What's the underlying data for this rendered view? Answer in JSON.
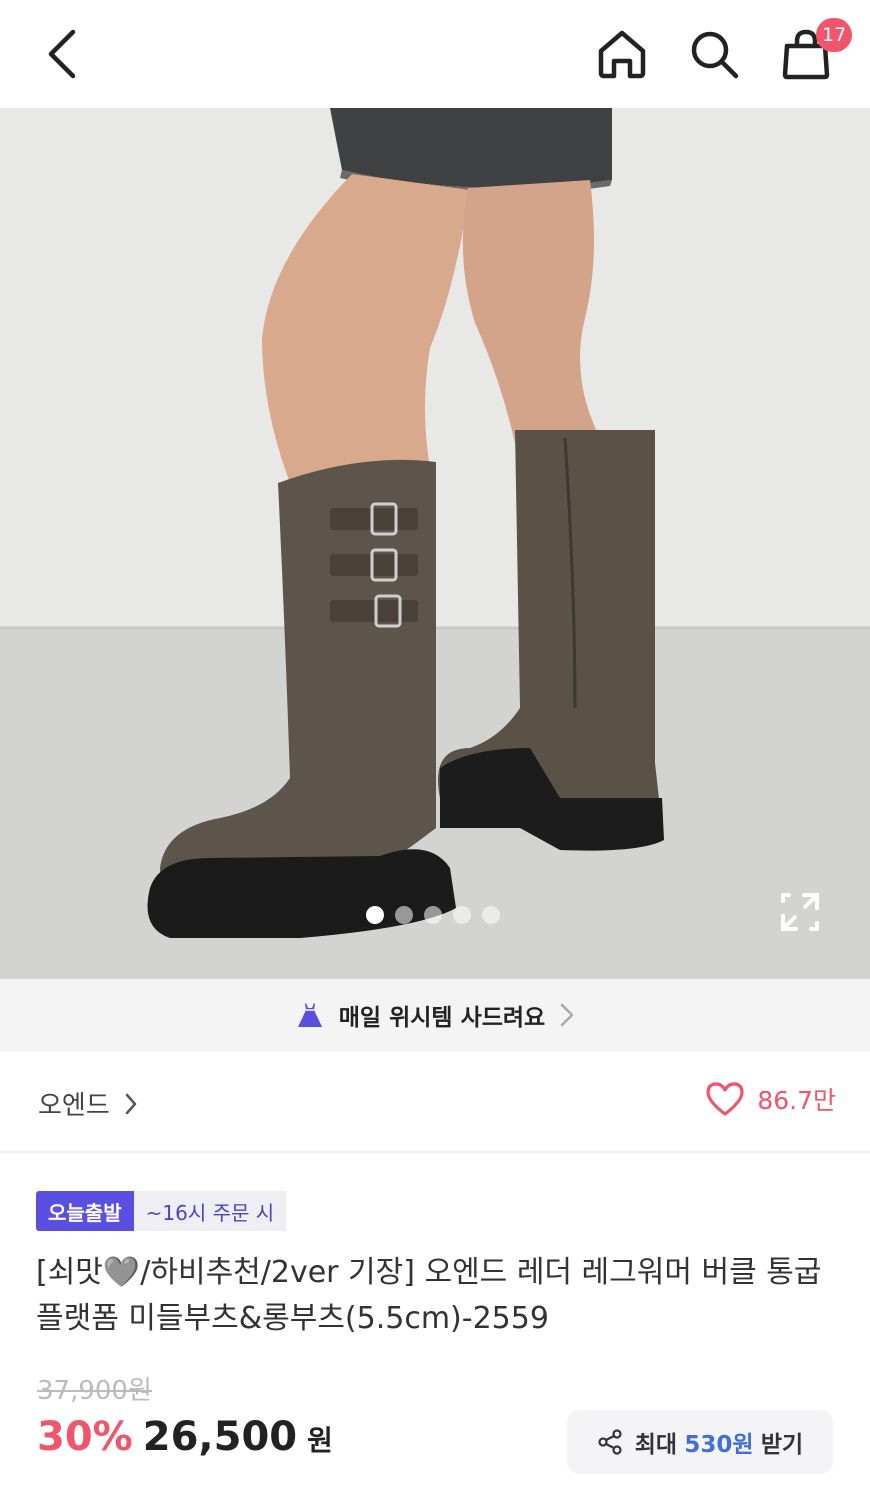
{
  "header": {
    "cart_badge": "17"
  },
  "icons": {
    "back": "chevron-left-icon",
    "home": "home-icon",
    "search": "search-icon",
    "cart": "shopping-bag-icon",
    "expand": "expand-icon",
    "banner": "dress-icon",
    "share": "share-icon",
    "like": "heart-icon"
  },
  "gallery": {
    "total_images": 5,
    "active_index": 0
  },
  "banner": {
    "text": "매일 위시템 사드려요"
  },
  "shop": {
    "name": "오엔드",
    "likes": "86.7만"
  },
  "tags": {
    "delivery": "오늘출발",
    "cutoff": "~16시 주문 시"
  },
  "product": {
    "title": "[쇠맛🩶/하비추천/2ver 기장] 오엔드 레더 레그워머 버클 통굽 플랫폼 미들부츠&롱부츠(5.5cm)-2559",
    "original_price": "37,900원",
    "discount": "30%",
    "price": "26,500",
    "currency": "원"
  },
  "coupon": {
    "prefix": "최대",
    "amount": "530원",
    "suffix": "받기"
  },
  "colors": {
    "accent_pink": "#f2556b",
    "badge_purple": "#5a4fe0",
    "coupon_blue": "#3f6fd8"
  }
}
